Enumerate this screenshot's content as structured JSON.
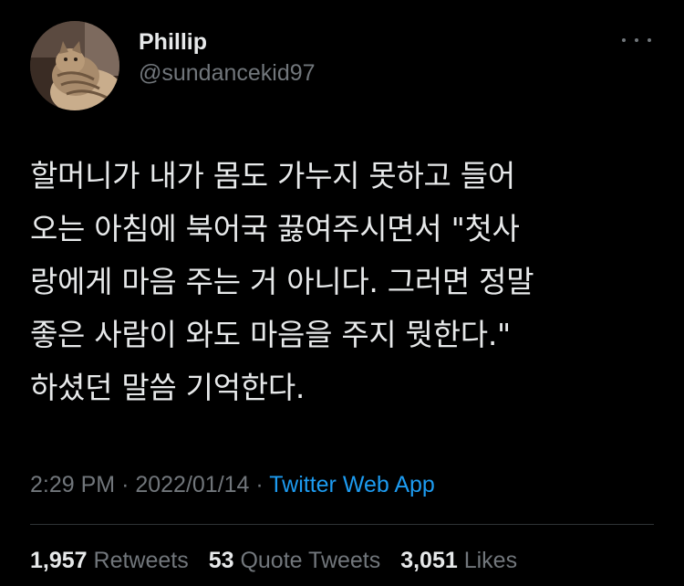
{
  "author": {
    "display_name": "Phillip",
    "handle": "@sundancekid97",
    "avatar_icon": "cat-avatar"
  },
  "more_icon": "more-horizontal-icon",
  "tweet": {
    "text": "할머니가 내가 몸도 가누지 못하고 들어\n오는 아침에 북어국 끓여주시면서 \"첫사\n랑에게 마음 주는 거 아니다. 그러면 정말\n좋은 사람이 와도 마음을 주지 뭣한다.\"\n하셨던 말씀 기억한다."
  },
  "meta": {
    "time": "2:29 PM",
    "separator": "·",
    "date": "2022/01/14",
    "source": "Twitter Web App"
  },
  "stats": {
    "retweets_count": "1,957",
    "retweets_label": "Retweets",
    "quotes_count": "53",
    "quotes_label": "Quote Tweets",
    "likes_count": "3,051",
    "likes_label": "Likes"
  },
  "colors": {
    "background": "#000000",
    "text": "#e7e9ea",
    "secondary": "#71767b",
    "link": "#1d9bf0",
    "divider": "#2f3336"
  }
}
